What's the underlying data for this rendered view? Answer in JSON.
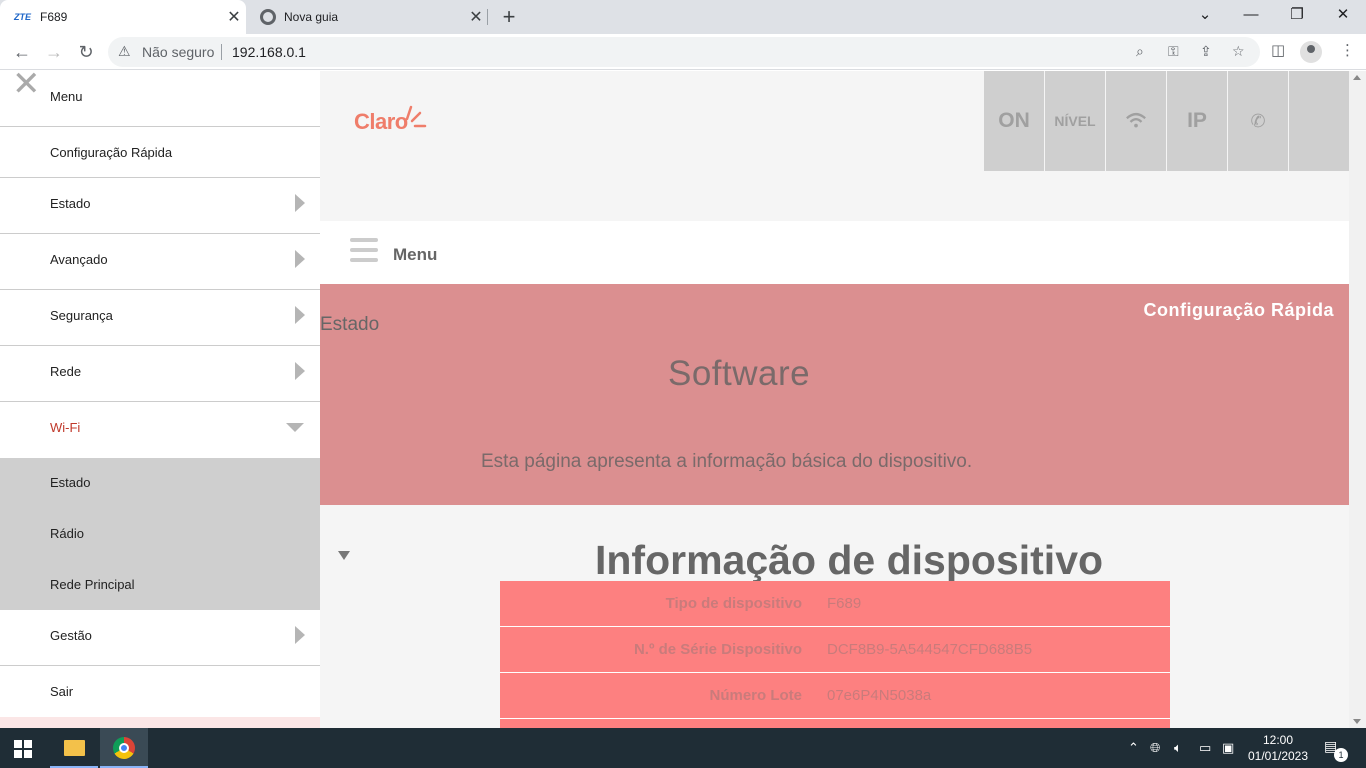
{
  "browser": {
    "tabs": [
      {
        "favicon": "ZTE",
        "title": "F689",
        "active": true
      },
      {
        "favicon": "chrome-icon",
        "title": "Nova guia",
        "active": false
      }
    ],
    "new_tab": "+",
    "window_controls": {
      "chevron": "⌄",
      "minimize": "—",
      "restore": "❐",
      "close": "✕"
    },
    "security_label": "Não seguro",
    "url": "192.168.0.1"
  },
  "sidebar": {
    "title": "Menu",
    "items": [
      {
        "label": "Configuração Rápida"
      },
      {
        "label": "Estado"
      },
      {
        "label": "Avançado"
      },
      {
        "label": "Segurança"
      },
      {
        "label": "Rede"
      },
      {
        "label": "Wi-Fi"
      },
      {
        "label": "Gestão"
      },
      {
        "label": "Sair"
      }
    ],
    "wifi_subitems": [
      {
        "label": "Estado"
      },
      {
        "label": "Rádio"
      },
      {
        "label": "Rede Principal"
      }
    ],
    "active_color": "#c0392b"
  },
  "header": {
    "logo_text": "Claro",
    "status": {
      "on": "ON",
      "level": "NÍVEL",
      "ip": "IP"
    }
  },
  "menubar": {
    "label": "Menu"
  },
  "banner": {
    "breadcrumb": "Estado",
    "quick_config": "Configuração Rápida",
    "title": "Software",
    "description": "Esta página apresenta a informação básica do dispositivo."
  },
  "device_info": {
    "title": "Informação de dispositivo",
    "rows": [
      {
        "label": "Tipo de dispositivo",
        "value": "F689"
      },
      {
        "label": "N.º de Série Dispositivo",
        "value": "DCF8B9-5A544547CFD688B5"
      },
      {
        "label": "Número Lote",
        "value": "07e6P4N5038a"
      }
    ]
  },
  "taskbar": {
    "time": "12:00",
    "date": "01/01/2023",
    "notifications": "1"
  }
}
